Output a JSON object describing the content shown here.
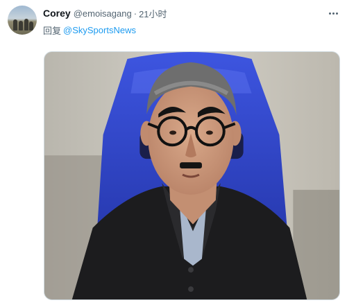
{
  "tweet": {
    "author_name": "Corey",
    "author_handle": "@emoisagang",
    "separator": "·",
    "timestamp": "21小时",
    "reply_prefix": "回复",
    "reply_to": "@SkySportsNews",
    "more_icon": "more-icon",
    "media_description_icon": "photo"
  },
  "colors": {
    "link": "#1d9bf0",
    "secondary_text": "#536471",
    "primary_text": "#0f1419",
    "seat_blue": "#2f45c9"
  }
}
